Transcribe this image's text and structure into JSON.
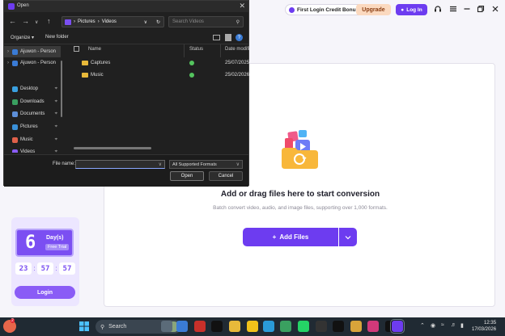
{
  "app": {
    "credit_bonus_label": "First Login Credit Bonus",
    "upgrade_label": "Upgrade",
    "login_label": "Log In",
    "drop_title": "Add or drag files here to start conversion",
    "drop_subtitle": "Batch convert video, audio, and image files, supporting over 1,000 formats.",
    "add_files_label": "Add Files",
    "promo": {
      "day_number": "6",
      "days_label": "Day(s)",
      "trial_label": "Free Trial",
      "timer": [
        "23",
        "57",
        "57"
      ],
      "login_label": "Login"
    },
    "brand_color": "#6d3cf0"
  },
  "dialog": {
    "title": "Open",
    "address": [
      "Pictures",
      "Videos"
    ],
    "search_placeholder": "Search Videos",
    "toolbar": {
      "organize_label": "Organize",
      "new_folder_label": "New folder",
      "help_label": "?"
    },
    "nav_items": [
      {
        "label": "Ajuwon - Person",
        "icon": "onedrive-icon",
        "color": "#3a7bd5"
      },
      {
        "label": "Ajuwon - Person",
        "icon": "onedrive-icon",
        "color": "#3a7bd5"
      },
      {
        "label": "Desktop",
        "icon": "desktop-icon",
        "color": "#3aa0e0"
      },
      {
        "label": "Downloads",
        "icon": "downloads-icon",
        "color": "#3aa060"
      },
      {
        "label": "Documents",
        "icon": "documents-icon",
        "color": "#5d8fd8"
      },
      {
        "label": "Pictures",
        "icon": "pictures-icon",
        "color": "#3a90d8"
      },
      {
        "label": "Music",
        "icon": "music-icon",
        "color": "#e0604a"
      },
      {
        "label": "Videos",
        "icon": "videos-icon",
        "color": "#8a5cf6"
      }
    ],
    "columns": {
      "name": "Name",
      "status": "Status",
      "date": "Date modifi"
    },
    "files": [
      {
        "name": "Captures",
        "date": "25/07/2025"
      },
      {
        "name": "Music",
        "date": "25/02/2026"
      }
    ],
    "file_name_label": "File name:",
    "file_name_value": "",
    "file_type_value": "All Supported Formats",
    "open_label": "Open",
    "cancel_label": "Cancel"
  },
  "taskbar": {
    "search_label": "Search",
    "weather_badge": "2",
    "time": "12:35",
    "date": "17/03/2026",
    "apps": [
      {
        "name": "taskbar-app-files",
        "color": "#5b6b79"
      },
      {
        "name": "taskbar-app-store",
        "color": "#3a7bd5"
      },
      {
        "name": "taskbar-app-acrobat",
        "color": "#c8302a"
      },
      {
        "name": "taskbar-app-netflix",
        "color": "#111111"
      },
      {
        "name": "taskbar-app-explorer",
        "color": "#e8b93a"
      },
      {
        "name": "taskbar-app-norton",
        "color": "#f2c21a"
      },
      {
        "name": "taskbar-app-edge",
        "color": "#2a9bd8"
      },
      {
        "name": "taskbar-app-chrome",
        "color": "#3aa060"
      },
      {
        "name": "taskbar-app-whatsapp",
        "color": "#25d366"
      },
      {
        "name": "taskbar-app-unknown",
        "color": "#333333"
      },
      {
        "name": "taskbar-app-tiktok",
        "color": "#111111"
      },
      {
        "name": "taskbar-app-chrome-2",
        "color": "#d8a43a"
      },
      {
        "name": "taskbar-app-instagram",
        "color": "#d2397a"
      },
      {
        "name": "taskbar-app-capcut",
        "color": "#111111"
      },
      {
        "name": "taskbar-app-converter",
        "color": "#6d3cf0"
      }
    ]
  }
}
